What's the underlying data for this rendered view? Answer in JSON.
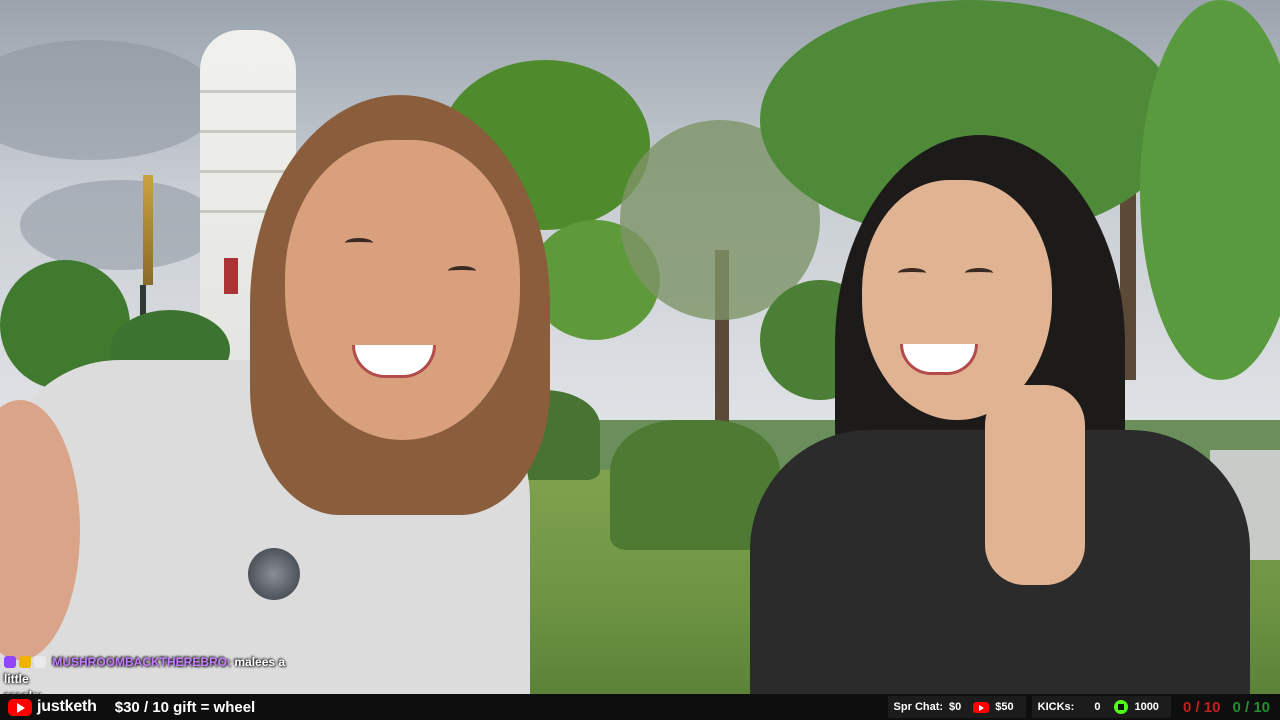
{
  "chat": {
    "username": "MUSHROOMBACKTHEREBRO:",
    "message": "malees a little",
    "message_continued": "cracky"
  },
  "bottom_bar": {
    "channel_name": "justketh",
    "goal_text": "$30 / 10 gift = wheel",
    "spr_chat_label": "Spr Chat:",
    "spr_chat_value": "$0",
    "youtube_value": "$50",
    "kicks_label": "KICKs:",
    "kicks_value": "0",
    "kick_value_2": "1000",
    "ratio_red": "0 / 10",
    "ratio_green": "0 / 10"
  },
  "colors": {
    "bar_background": "#0e0e0e",
    "youtube_red": "#ff0000",
    "chat_username": "#c77dff",
    "kick_green": "#53fc18",
    "ratio_red": "#c71e1e",
    "ratio_green": "#1f8f2f"
  },
  "icons": [
    "youtube-logo-icon",
    "kick-logo-icon",
    "chat-badge-icon"
  ]
}
